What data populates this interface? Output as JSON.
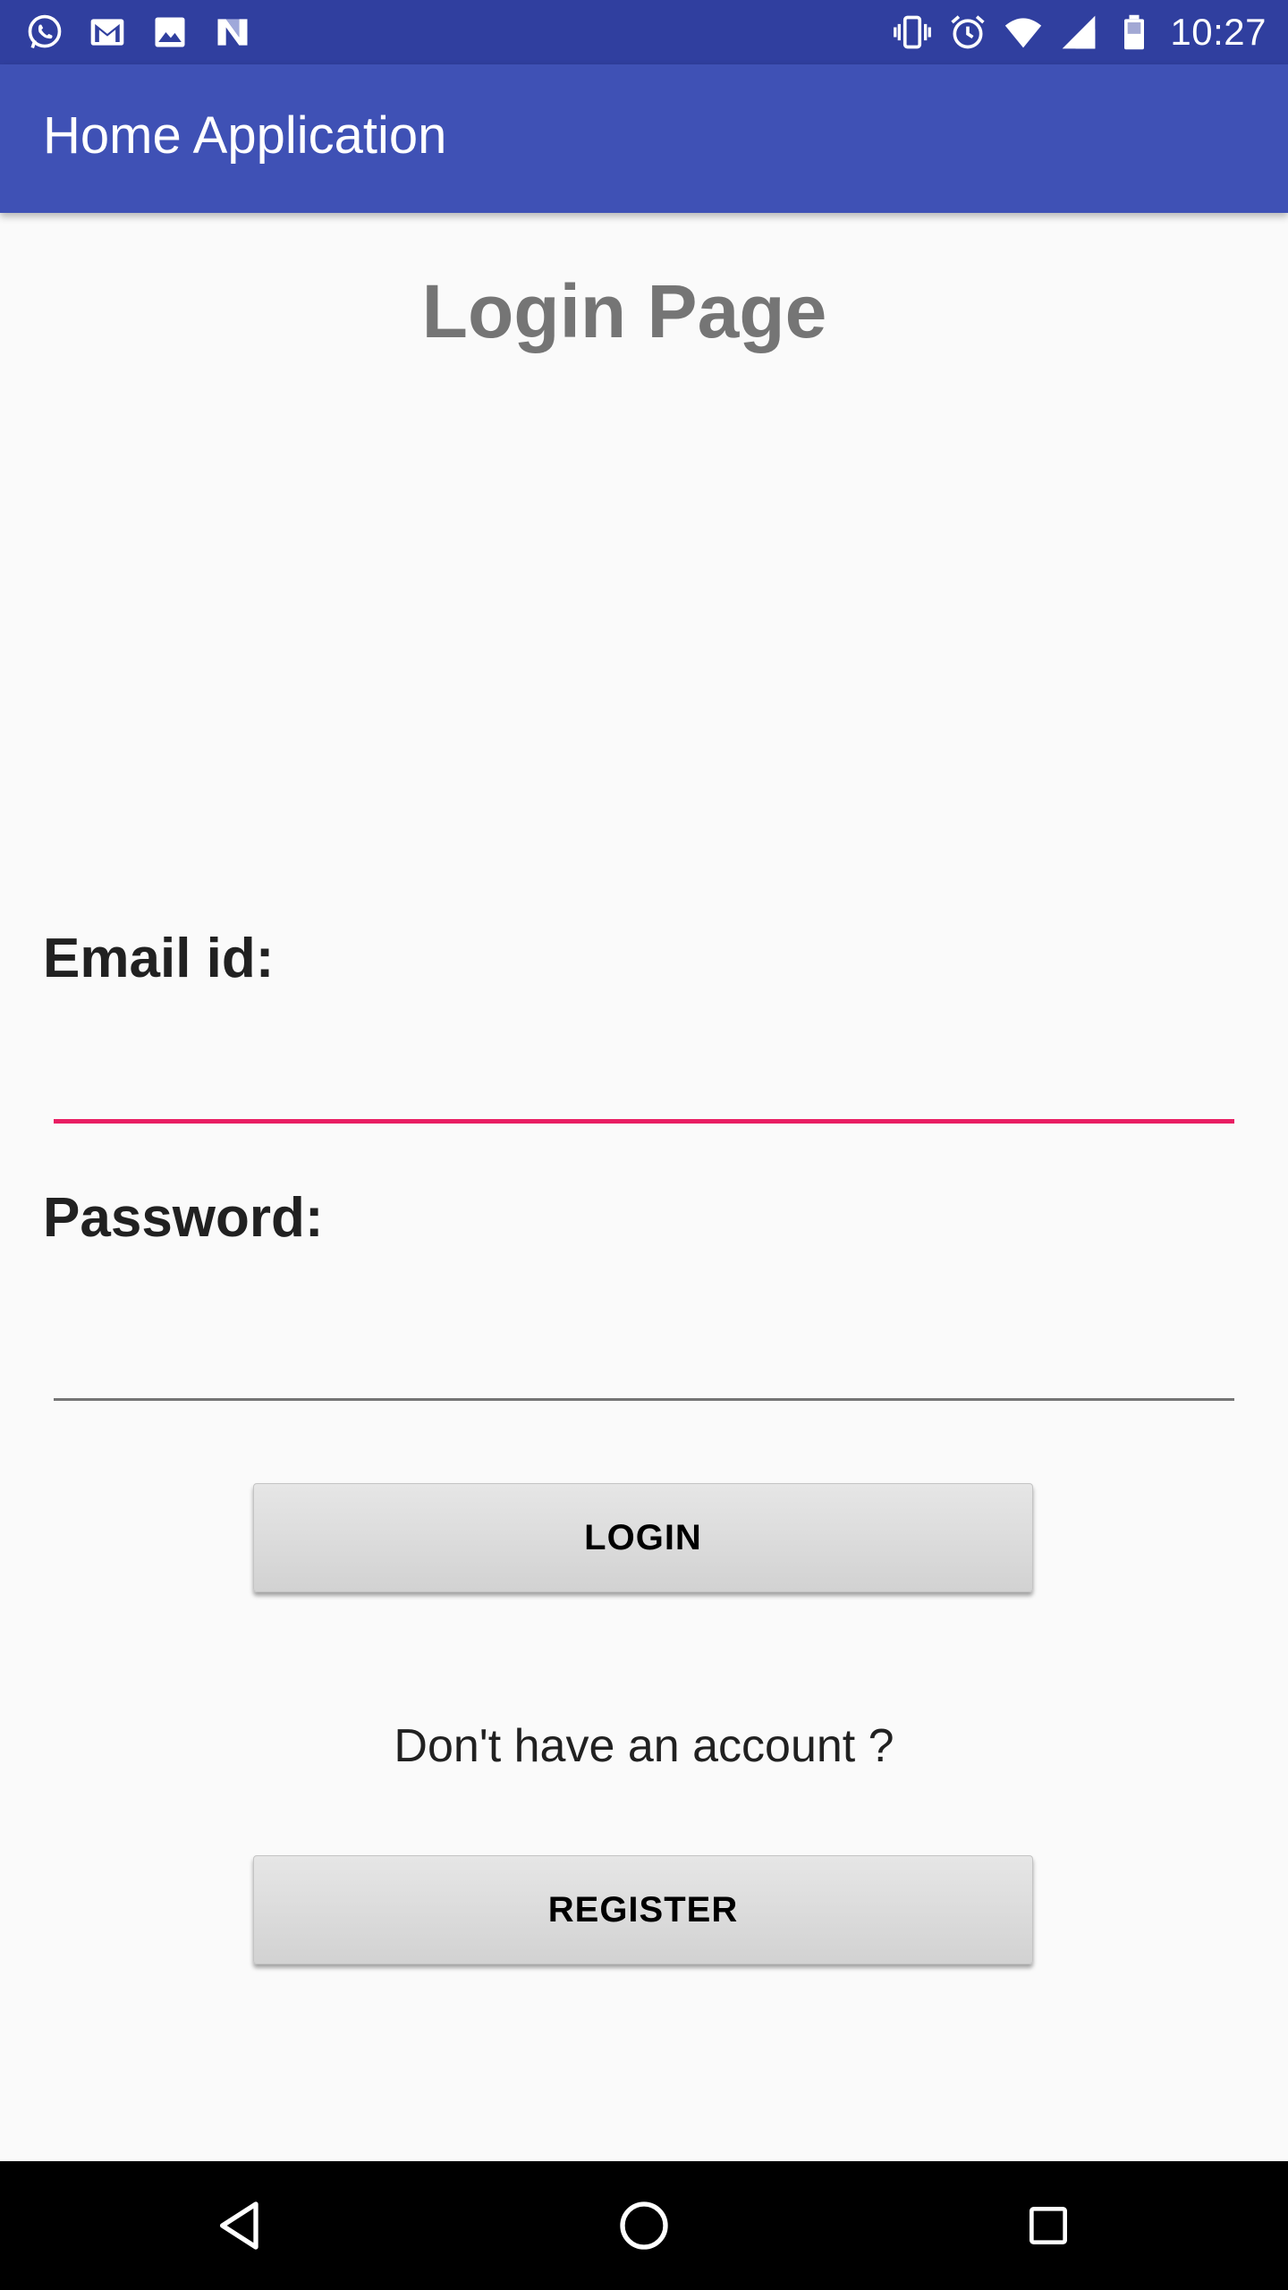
{
  "status_bar": {
    "time": "10:27",
    "notification_icons": [
      "whatsapp-icon",
      "gmail-icon",
      "image-icon",
      "n-icon"
    ],
    "system_icons": [
      "vibrate-icon",
      "alarm-icon",
      "wifi-icon",
      "signal-icon",
      "battery-icon"
    ]
  },
  "app_bar": {
    "title": "Home Application",
    "color": "#3F51B5",
    "status_color": "#303F9F"
  },
  "main": {
    "page_title": "Login Page",
    "email": {
      "label": "Email id:",
      "value": "",
      "accent": "#E91E63"
    },
    "password": {
      "label": "Password:",
      "value": ""
    },
    "login_button": "LOGIN",
    "account_prompt": "Don't have an account ?",
    "register_button": "REGISTER"
  },
  "nav_bar": {
    "buttons": [
      "back-icon",
      "home-icon",
      "recents-icon"
    ]
  }
}
